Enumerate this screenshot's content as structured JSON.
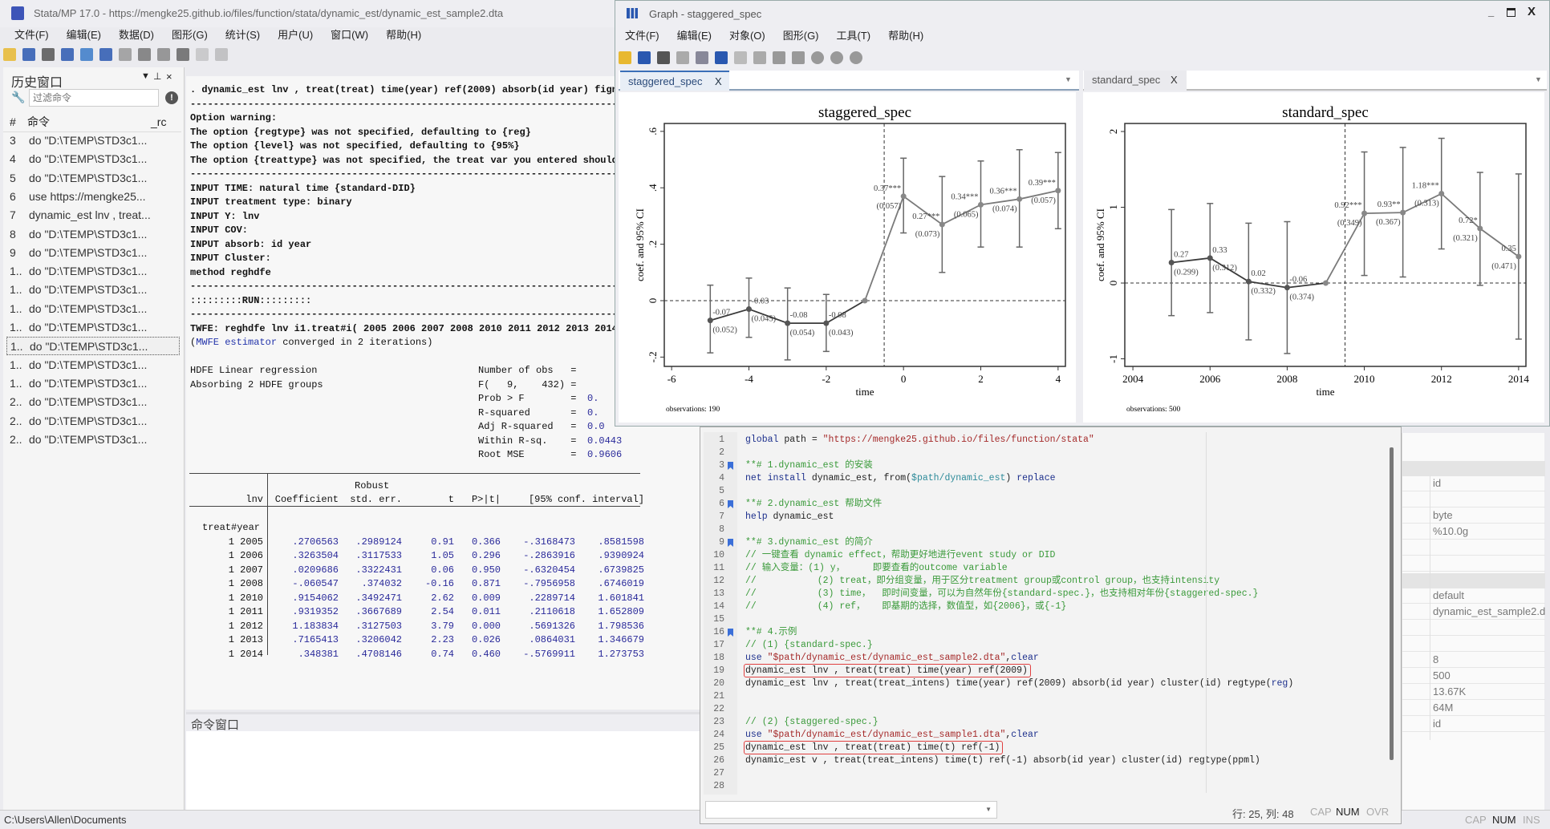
{
  "app": {
    "title": "Stata/MP 17.0 - https://mengke25.github.io/files/function/stata/dynamic_est/dynamic_est_sample2.dta",
    "menu": [
      "文件(F)",
      "编辑(E)",
      "数据(D)",
      "图形(G)",
      "统计(S)",
      "用户(U)",
      "窗口(W)",
      "帮助(H)"
    ],
    "toolbar_icons": [
      "open-icon",
      "save-icon",
      "print-icon",
      "log-icon",
      "viewer-icon",
      "graph-icon",
      "dofile-icon",
      "data-editor-icon",
      "data-browser-icon",
      "variables-icon",
      "break-icon",
      "stop-icon"
    ],
    "status_path": "C:\\Users\\Allen\\Documents",
    "status_flags": [
      "CAP",
      "NUM",
      "INS"
    ]
  },
  "history": {
    "title": "历史窗口",
    "filter_placeholder": "过滤命令",
    "col_num": "#",
    "col_cmd": "命令",
    "col_rc": "_rc",
    "selected_index": 11,
    "rows": [
      {
        "n": "3",
        "cmd": "do \"D:\\TEMP\\STD3c1..."
      },
      {
        "n": "4",
        "cmd": "do \"D:\\TEMP\\STD3c1..."
      },
      {
        "n": "5",
        "cmd": "do \"D:\\TEMP\\STD3c1..."
      },
      {
        "n": "6",
        "cmd": "use https://mengke25..."
      },
      {
        "n": "7",
        "cmd": "dynamic_est lnv , treat..."
      },
      {
        "n": "8",
        "cmd": "do \"D:\\TEMP\\STD3c1..."
      },
      {
        "n": "9",
        "cmd": "do \"D:\\TEMP\\STD3c1..."
      },
      {
        "n": "1..",
        "cmd": "do \"D:\\TEMP\\STD3c1..."
      },
      {
        "n": "1..",
        "cmd": "do \"D:\\TEMP\\STD3c1..."
      },
      {
        "n": "1..",
        "cmd": "do \"D:\\TEMP\\STD3c1..."
      },
      {
        "n": "1..",
        "cmd": "do \"D:\\TEMP\\STD3c1..."
      },
      {
        "n": "1..",
        "cmd": "do \"D:\\TEMP\\STD3c1..."
      },
      {
        "n": "1..",
        "cmd": "do \"D:\\TEMP\\STD3c1..."
      },
      {
        "n": "1..",
        "cmd": "do \"D:\\TEMP\\STD3c1..."
      },
      {
        "n": "2..",
        "cmd": "do \"D:\\TEMP\\STD3c1..."
      },
      {
        "n": "2..",
        "cmd": "do \"D:\\TEMP\\STD3c1..."
      },
      {
        "n": "2..",
        "cmd": "do \"D:\\TEMP\\STD3c1..."
      }
    ]
  },
  "results": {
    "lines": [
      {
        "row": 0,
        "b": true,
        "segs": [
          [
            "t",
            ". dynamic_est lnv , treat(treat) time(year) ref(2009) absorb(id year) fign"
          ]
        ]
      },
      {
        "row": 1,
        "b": true,
        "segs": [
          [
            "t",
            "--------------------------------------------------------------------------------"
          ]
        ]
      },
      {
        "row": 2,
        "b": true,
        "segs": [
          [
            "t",
            "Option warning:"
          ]
        ]
      },
      {
        "row": 3,
        "b": true,
        "segs": [
          [
            "t",
            "The option {regtype} was not specified, defaulting to {reg}"
          ]
        ]
      },
      {
        "row": 4,
        "b": true,
        "segs": [
          [
            "t",
            "The option {level} was not specified, defaulting to {95%}"
          ]
        ]
      },
      {
        "row": 5,
        "b": true,
        "segs": [
          [
            "t",
            "The option {treattype} was not specified, the treat var you entered should"
          ]
        ]
      },
      {
        "row": 6,
        "b": true,
        "segs": [
          [
            "t",
            "--------------------------------------------------------------------------------"
          ]
        ]
      },
      {
        "row": 7,
        "b": true,
        "segs": [
          [
            "t",
            "INPUT TIME: natural time {standard-DID}"
          ]
        ]
      },
      {
        "row": 8,
        "b": true,
        "segs": [
          [
            "t",
            "INPUT treatment type: binary"
          ]
        ]
      },
      {
        "row": 9,
        "b": true,
        "segs": [
          [
            "t",
            "INPUT Y: lnv"
          ]
        ]
      },
      {
        "row": 10,
        "b": true,
        "segs": [
          [
            "t",
            "INPUT COV:"
          ]
        ]
      },
      {
        "row": 11,
        "b": true,
        "segs": [
          [
            "t",
            "INPUT absorb: id year"
          ]
        ]
      },
      {
        "row": 12,
        "b": true,
        "segs": [
          [
            "t",
            "INPUT Cluster:"
          ]
        ]
      },
      {
        "row": 13,
        "b": true,
        "segs": [
          [
            "t",
            "method reghdfe"
          ]
        ]
      },
      {
        "row": 14,
        "b": true,
        "segs": [
          [
            "t",
            "--------------------------------------------------------------------------------"
          ]
        ]
      },
      {
        "row": 15,
        "b": true,
        "segs": [
          [
            "t",
            ":::::::::RUN:::::::::"
          ]
        ]
      },
      {
        "row": 16,
        "b": true,
        "segs": [
          [
            "t",
            "--------------------------------------------------------------------------------"
          ]
        ]
      },
      {
        "row": 17,
        "b": true,
        "segs": [
          [
            "t",
            "TWFE: reghdfe lnv i1.treat#i( 2005 2006 2007 2008 2010 2011 2012 2013 2014"
          ]
        ]
      },
      {
        "row": 18,
        "b": false,
        "segs": [
          [
            "t",
            "("
          ],
          [
            "blue",
            "MWFE estimator"
          ],
          [
            "t",
            " converged in 2 iterations)"
          ]
        ]
      },
      {
        "row": 20,
        "b": false,
        "segs": [
          [
            "t",
            "HDFE Linear regression"
          ]
        ]
      },
      {
        "row": 21,
        "b": false,
        "segs": [
          [
            "t",
            "Absorbing 2 HDFE groups"
          ]
        ]
      }
    ],
    "stats": [
      {
        "label": "Number of obs   =",
        "value": ""
      },
      {
        "label": "F(   9,    432) =",
        "value": ""
      },
      {
        "label": "Prob > F        =",
        "value": "0."
      },
      {
        "label": "R-squared       =",
        "value": "0."
      },
      {
        "label": "Adj R-squared   =",
        "value": "0.0"
      },
      {
        "label": "Within R-sq.    =",
        "value": "0.0443"
      },
      {
        "label": "Root MSE        =",
        "value": "0.9606"
      }
    ],
    "table": {
      "robust_label": "Robust",
      "headers": [
        "lnv",
        "Coefficient",
        "std. err.",
        "t",
        "P>|t|",
        "[95% conf. interval]"
      ],
      "group_label": "treat#year",
      "rows": [
        [
          "1 2005",
          ".2706563",
          ".2989124",
          "0.91",
          "0.366",
          "-.3168473",
          ".8581598"
        ],
        [
          "1 2006",
          ".3263504",
          ".3117533",
          "1.05",
          "0.296",
          "-.2863916",
          ".9390924"
        ],
        [
          "1 2007",
          ".0209686",
          ".3322431",
          "0.06",
          "0.950",
          "-.6320454",
          ".6739825"
        ],
        [
          "1 2008",
          "-.060547",
          ".374032",
          "-0.16",
          "0.871",
          "-.7956958",
          ".6746019"
        ],
        [
          "1 2010",
          ".9154062",
          ".3492471",
          "2.62",
          "0.009",
          ".2289714",
          "1.601841"
        ],
        [
          "1 2011",
          ".9319352",
          ".3667689",
          "2.54",
          "0.011",
          ".2110618",
          "1.652809"
        ],
        [
          "1 2012",
          "1.183834",
          ".3127503",
          "3.79",
          "0.000",
          ".5691326",
          "1.798536"
        ],
        [
          "1 2013",
          ".7165413",
          ".3206042",
          "2.23",
          "0.026",
          ".0864031",
          "1.346679"
        ],
        [
          "1 2014",
          ".348381",
          ".4708146",
          "0.74",
          "0.460",
          "-.5769911",
          "1.273753"
        ]
      ]
    }
  },
  "command_window": {
    "title": "命令窗口"
  },
  "graph_window": {
    "title": "Graph - staggered_spec",
    "menu": [
      "文件(F)",
      "编辑(E)",
      "对象(O)",
      "图形(G)",
      "工具(T)",
      "帮助(H)"
    ],
    "tabs": [
      {
        "label": "staggered_spec",
        "active": true
      },
      {
        "label": "standard_spec",
        "active": false
      }
    ],
    "close_glyph": "X"
  },
  "chart_data": [
    {
      "type": "line",
      "title": "staggered_spec",
      "xlabel": "time",
      "ylabel": "coef. and 95% CI",
      "note": "observations: 190",
      "xlim": [
        -6.19,
        4.19
      ],
      "ylim": [
        -0.233,
        0.628
      ],
      "xticks": [
        -6,
        -4,
        -2,
        0,
        2,
        4
      ],
      "xtick_labels": [
        "-6",
        "-4",
        "-2",
        "0",
        "2",
        "4"
      ],
      "yticks": [
        -0.2,
        0,
        0.2,
        0.4,
        0.6
      ],
      "ytick_labels": [
        "-.2",
        "0",
        ".2",
        ".4",
        ".6"
      ],
      "ref_line_x": -0.5,
      "ref_x": -1,
      "grid": false,
      "colors": {
        "pre": "#3a3a3a",
        "post": "#7a7a7a",
        "ci": "#666666"
      },
      "x": [
        -5,
        -4,
        -3,
        -2,
        -1,
        0,
        1,
        2,
        3,
        4
      ],
      "coef": [
        -0.07,
        -0.03,
        -0.08,
        -0.08,
        0,
        0.37,
        0.27,
        0.34,
        0.36,
        0.39
      ],
      "ci_low": [
        -0.185,
        -0.13,
        -0.21,
        -0.18,
        null,
        0.24,
        0.1,
        0.19,
        0.19,
        0.255
      ],
      "ci_high": [
        0.055,
        0.08,
        0.045,
        0.022,
        null,
        0.505,
        0.44,
        0.495,
        0.535,
        0.525
      ],
      "coef_labels": [
        "-0.07",
        "-0.03",
        "-0.08",
        "-0.08",
        "",
        "0.37***",
        "0.27***",
        "0.34***",
        "0.36***",
        "0.39***"
      ],
      "se_labels": [
        "(0.052)",
        "(0.045)",
        "(0.054)",
        "(0.043)",
        "",
        "(0.057)",
        "(0.073)",
        "(0.065)",
        "(0.074)",
        "(0.057)"
      ]
    },
    {
      "type": "line",
      "title": "standard_spec",
      "xlabel": "time",
      "ylabel": "coef. and 95% CI",
      "note": "observations: 500",
      "xlim": [
        2003.79,
        2014.19
      ],
      "ylim": [
        -1.1,
        2.106
      ],
      "xticks": [
        2004,
        2006,
        2008,
        2010,
        2012,
        2014
      ],
      "xtick_labels": [
        "2004",
        "2006",
        "2008",
        "2010",
        "2012",
        "2014"
      ],
      "yticks": [
        -1,
        0,
        1,
        2
      ],
      "ytick_labels": [
        "-1",
        "0",
        "1",
        "2"
      ],
      "ref_line_x": 2009.5,
      "ref_x": 2009,
      "grid": false,
      "colors": {
        "pre": "#3a3a3a",
        "post": "#7a7a7a",
        "ci": "#666666"
      },
      "x": [
        2005,
        2006,
        2007,
        2008,
        2009,
        2010,
        2011,
        2012,
        2013,
        2014
      ],
      "coef": [
        0.27,
        0.33,
        0.02,
        -0.06,
        0,
        0.92,
        0.93,
        1.18,
        0.72,
        0.35
      ],
      "ci_low": [
        -0.43,
        -0.39,
        -0.75,
        -0.93,
        null,
        0.1,
        0.08,
        0.45,
        -0.03,
        -0.74
      ],
      "ci_high": [
        0.97,
        1.05,
        0.79,
        0.81,
        null,
        1.73,
        1.79,
        1.91,
        1.46,
        1.44
      ],
      "coef_labels": [
        "0.27",
        "0.33",
        "0.02",
        "-0.06",
        "",
        "0.92***",
        "0.93**",
        "1.18***",
        "0.72*",
        "0.35"
      ],
      "se_labels": [
        "(0.299)",
        "(0.312)",
        "(0.332)",
        "(0.374)",
        "",
        "(0.349)",
        "(0.367)",
        "(0.313)",
        "(0.321)",
        "(0.471)"
      ]
    }
  ],
  "editor": {
    "status_pos": "行: 25, 列: 48",
    "status_flags": [
      "CAP",
      "NUM",
      "OVR"
    ],
    "lines": [
      {
        "n": "1",
        "segs": [
          [
            "k",
            "global"
          ],
          [
            "t",
            " path = "
          ],
          [
            "s",
            "\"https://mengke25.github.io/files/function/stata\""
          ]
        ]
      },
      {
        "n": "2",
        "segs": []
      },
      {
        "n": "3",
        "bm": true,
        "segs": [
          [
            "c",
            "**# 1.dynamic_est 的安装"
          ]
        ]
      },
      {
        "n": "4",
        "segs": [
          [
            "k",
            "net install"
          ],
          [
            "t",
            " dynamic_est, from("
          ],
          [
            "m",
            "$path/dynamic_est"
          ],
          [
            "t",
            ") "
          ],
          [
            "k",
            "replace"
          ]
        ]
      },
      {
        "n": "5",
        "segs": []
      },
      {
        "n": "6",
        "bm": true,
        "segs": [
          [
            "c",
            "**# 2.dynamic_est 帮助文件"
          ]
        ]
      },
      {
        "n": "7",
        "segs": [
          [
            "k",
            "help"
          ],
          [
            "t",
            " dynamic_est"
          ]
        ]
      },
      {
        "n": "8",
        "segs": []
      },
      {
        "n": "9",
        "bm": true,
        "segs": [
          [
            "c",
            "**# 3.dynamic_est 的简介"
          ]
        ]
      },
      {
        "n": "10",
        "segs": [
          [
            "c",
            "// 一键查看 dynamic effect，帮助更好地进行event study or DID"
          ]
        ]
      },
      {
        "n": "11",
        "segs": [
          [
            "c",
            "// 输入变量：(1) y，     即要查看的outcome variable"
          ]
        ]
      },
      {
        "n": "12",
        "segs": [
          [
            "c",
            "//           (2) treat，即分组变量，用于区分treatment group或control group，也支持intensity"
          ]
        ]
      },
      {
        "n": "13",
        "segs": [
          [
            "c",
            "//           (3) time，  即时间变量，可以为自然年份{standard-spec.}，也支持相对年份{staggered-spec.}"
          ]
        ]
      },
      {
        "n": "14",
        "segs": [
          [
            "c",
            "//           (4) ref，   即基期的选择，数值型，如{2006}，或{-1}"
          ]
        ]
      },
      {
        "n": "15",
        "segs": []
      },
      {
        "n": "16",
        "bm": true,
        "segs": [
          [
            "c",
            "**# 4.示例"
          ]
        ]
      },
      {
        "n": "17",
        "segs": [
          [
            "c",
            "// (1) {standard-spec.}"
          ]
        ]
      },
      {
        "n": "18",
        "segs": [
          [
            "k",
            "use"
          ],
          [
            "t",
            " "
          ],
          [
            "s",
            "\"$path/dynamic_est/dynamic_est_sample2.dta\""
          ],
          [
            "t",
            ","
          ],
          [
            "k",
            "clear"
          ]
        ]
      },
      {
        "n": "19",
        "box": true,
        "segs": [
          [
            "t",
            "dynamic_est lnv , treat(treat) time(year) ref(2009)"
          ]
        ]
      },
      {
        "n": "20",
        "segs": [
          [
            "t",
            "dynamic_est lnv , treat(treat_intens) time(year) ref(2009) absorb(id year) cluster(id) regtype("
          ],
          [
            "k",
            "reg"
          ],
          [
            "t",
            ")"
          ]
        ]
      },
      {
        "n": "21",
        "segs": []
      },
      {
        "n": "22",
        "segs": []
      },
      {
        "n": "23",
        "segs": [
          [
            "c",
            "// (2) {staggered-spec.}"
          ]
        ]
      },
      {
        "n": "24",
        "segs": [
          [
            "k",
            "use"
          ],
          [
            "t",
            " "
          ],
          [
            "s",
            "\"$path/dynamic_est/dynamic_est_sample1.dta\""
          ],
          [
            "t",
            ","
          ],
          [
            "k",
            "clear"
          ]
        ]
      },
      {
        "n": "25",
        "box": true,
        "segs": [
          [
            "t",
            "dynamic_est lnv , treat(treat) time(t) ref(-1)"
          ]
        ]
      },
      {
        "n": "26",
        "segs": [
          [
            "t",
            "dynamic_est v , treat(treat_intens) time(t) ref(-1) absorb(id year) cluster(id) regtype(ppml)"
          ]
        ]
      },
      {
        "n": "27",
        "segs": []
      },
      {
        "n": "28",
        "segs": []
      }
    ]
  },
  "properties": {
    "values": [
      {
        "row": 1,
        "v": "id"
      },
      {
        "row": 2,
        "v": ""
      },
      {
        "row": 3,
        "v": "byte"
      },
      {
        "row": 4,
        "v": "%10.0g"
      },
      {
        "row": 5,
        "v": ""
      },
      {
        "row": 6,
        "v": ""
      },
      {
        "row": 8,
        "v": "default"
      },
      {
        "row": 9,
        "v": "dynamic_est_sample2.d"
      },
      {
        "row": 10,
        "v": ""
      },
      {
        "row": 11,
        "v": ""
      },
      {
        "row": 12,
        "v": "8"
      },
      {
        "row": 13,
        "v": "500"
      },
      {
        "row": 14,
        "v": "13.67K"
      },
      {
        "row": 15,
        "v": "64M"
      },
      {
        "row": 16,
        "v": "id"
      }
    ],
    "header_rows": [
      0,
      7
    ]
  }
}
